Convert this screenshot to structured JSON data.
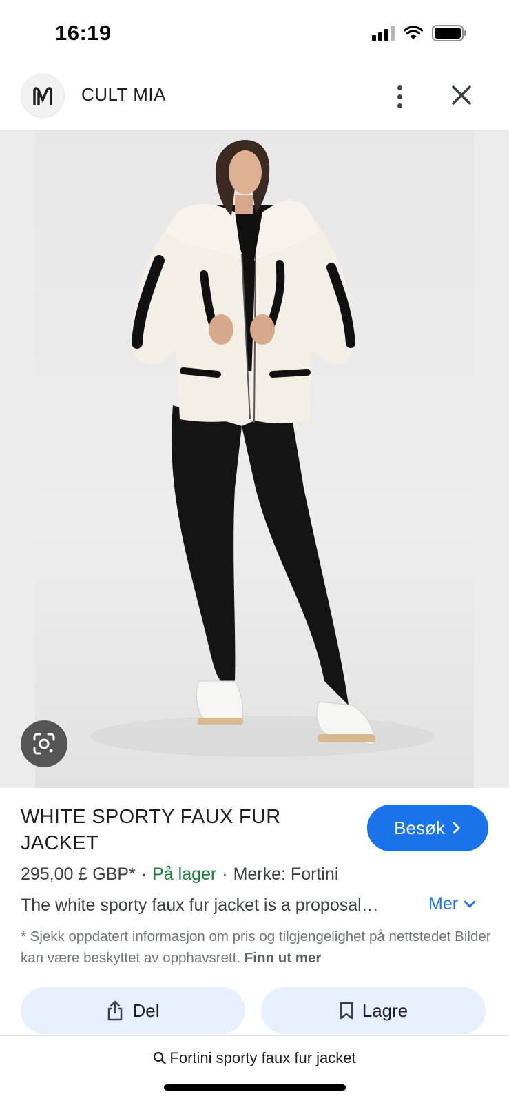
{
  "status_bar": {
    "time": "16:19"
  },
  "header": {
    "site_name": "CULT MIA",
    "logo_icon": "cult-mia-logo"
  },
  "product": {
    "title": "WHITE SPORTY FAUX FUR JACKET",
    "price": "295,00 £ GBP*",
    "separator": "·",
    "stock": "På lager",
    "brand": "Merke: Fortini",
    "description": "The white sporty faux fur jacket is a proposal…",
    "more_label": "Mer"
  },
  "visit_button": {
    "label": "Besøk"
  },
  "notice": {
    "text": "* Sjekk oppdatert informasjon om pris og tilgjengelighet på nettstedet Bilder kan være beskyttet av opphavsrett.",
    "link": "Finn ut mer"
  },
  "actions": {
    "share_label": "Del",
    "save_label": "Lagre"
  },
  "bottom_search": {
    "query": "Fortini sporty faux fur jacket"
  },
  "colors": {
    "accent": "#1a73e8",
    "stock_green": "#188038",
    "action_bg": "#e8f0fe"
  }
}
